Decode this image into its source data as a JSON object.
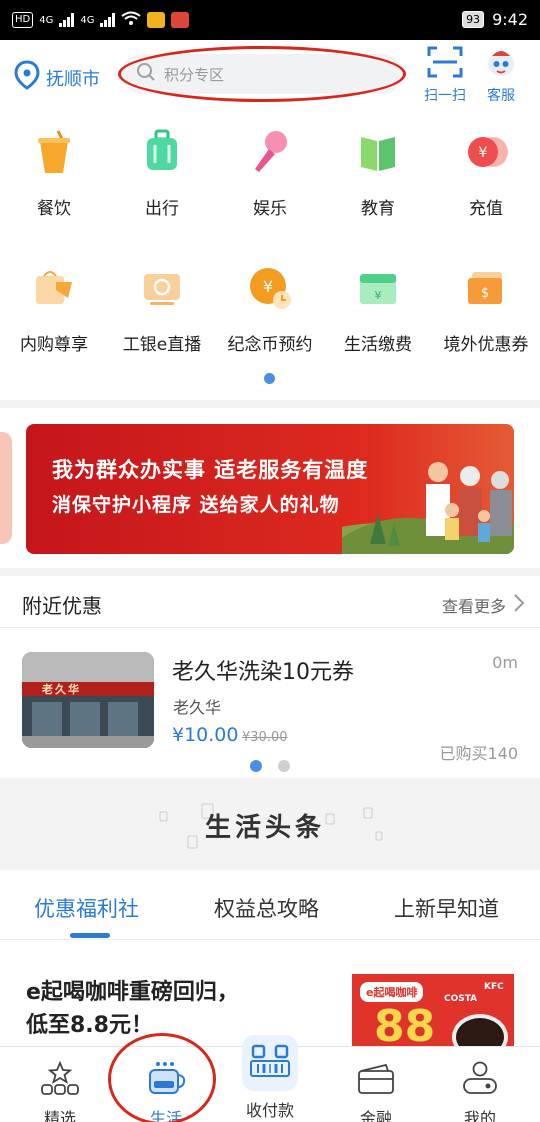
{
  "status_bar": {
    "network_label": "HD",
    "signal_1": "4G",
    "signal_2": "4G",
    "battery": "93",
    "time": "9:42"
  },
  "header": {
    "city": "抚顺市",
    "search_placeholder": "积分专区",
    "scan_label": "扫一扫",
    "service_label": "客服"
  },
  "services": [
    {
      "label": "餐饮",
      "icon": "drink-cup-icon"
    },
    {
      "label": "出行",
      "icon": "luggage-icon"
    },
    {
      "label": "娱乐",
      "icon": "microphone-icon"
    },
    {
      "label": "教育",
      "icon": "book-icon"
    },
    {
      "label": "充值",
      "icon": "coin-icon"
    },
    {
      "label": "内购尊享",
      "icon": "shopping-bag-icon"
    },
    {
      "label": "工银e直播",
      "icon": "live-tv-icon"
    },
    {
      "label": "纪念币预约",
      "icon": "commemorative-coin-icon"
    },
    {
      "label": "生活缴费",
      "icon": "bill-icon"
    },
    {
      "label": "境外优惠券",
      "icon": "card-icon"
    }
  ],
  "banner": {
    "line1": "我为群众办实事 适老服务有温度",
    "line2": "消保守护小程序 送给家人的礼物"
  },
  "nearby": {
    "title": "附近优惠",
    "more": "查看更多",
    "deal": {
      "title": "老久华洗染10元券",
      "distance": "0m",
      "shop": "老久华",
      "price": "¥10.00",
      "original_price": "¥30.00",
      "sold": "已购买140",
      "storefront_sign": "老久华"
    }
  },
  "headline": {
    "title": "生活头条"
  },
  "tabs": [
    {
      "label": "优惠福利社",
      "active": true
    },
    {
      "label": "权益总攻略",
      "active": false
    },
    {
      "label": "上新早知道",
      "active": false
    }
  ],
  "article": {
    "title_line1": "e起喝咖啡重磅回归，",
    "title_line2": "低至8.8元！",
    "promo_badge": "e起喝咖啡",
    "promo_number": "88",
    "brand_1": "COSTA",
    "brand_2": "KFC"
  },
  "bottom_nav": [
    {
      "label": "精选",
      "icon": "star-blocks-icon",
      "active": false
    },
    {
      "label": "生活",
      "icon": "coffee-cup-icon",
      "active": true
    },
    {
      "label": "收付款",
      "icon": "qr-scan-icon",
      "active": false
    },
    {
      "label": "金融",
      "icon": "wallet-card-icon",
      "active": false
    },
    {
      "label": "我的",
      "icon": "user-profile-icon",
      "active": false
    }
  ],
  "colors": {
    "accent": "#2b7bd6",
    "annotation_red": "#d9261c",
    "banner_red": "#d41f1f"
  }
}
